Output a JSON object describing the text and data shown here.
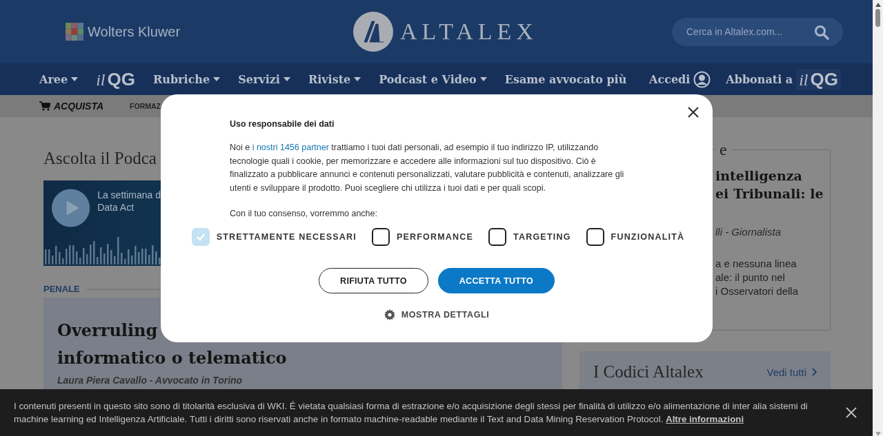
{
  "header": {
    "brand": "Wolters Kluwer",
    "logo": "ALTALEX",
    "search": {
      "placeholder": "Cerca in Altalex.com..."
    }
  },
  "nav": {
    "items": [
      {
        "label": "Aree",
        "kind": "menu",
        "dropdown": true
      },
      {
        "prefix": "il",
        "label": "QG",
        "kind": "logo",
        "dropdown": false
      },
      {
        "label": "Rubriche",
        "kind": "menu",
        "dropdown": true
      },
      {
        "label": "Servizi",
        "kind": "menu",
        "dropdown": true
      },
      {
        "label": "Riviste",
        "kind": "menu",
        "dropdown": true
      },
      {
        "label": "Podcast e Video",
        "kind": "menu",
        "dropdown": true
      },
      {
        "label": "Esame avvocato più",
        "kind": "menu",
        "dropdown": false
      }
    ],
    "login": "Accedi",
    "subscribe": "Abbonati a",
    "subscribe_logo": {
      "prefix": "il",
      "label": "QG"
    }
  },
  "subnav": {
    "items": [
      "ACQUISTA",
      "FORMAZ"
    ]
  },
  "podcast": {
    "heading": "Ascolta il Podca",
    "title_lines": [
      "La settimana d",
      "Data Act"
    ]
  },
  "article": {
    "category": "PENALE",
    "title_lines": [
      "Overruling",
      "informatico o telematico"
    ],
    "author": "Laura Piera Cavallo - Avvocato in Torino"
  },
  "side_box": {
    "legend": "e",
    "title_lines": [
      "intelligenza",
      "ei Tribunali: le"
    ],
    "author": "lli - Giornalista",
    "text_lines": [
      "a e nessuna linea",
      "ale: il punto nel",
      "i Osservatori della"
    ]
  },
  "codes": {
    "title": "I Codici Altalex",
    "link": "Vedi tutti"
  },
  "consent": {
    "title": "Uso responsabile dei dati",
    "intro_before": "Noi e ",
    "partners_link": "i nostri 1456 partner",
    "intro_after": " trattiamo i tuoi dati personali, ad esempio il tuo indirizzo IP, utilizzando tecnologie quali i cookie, per memorizzare e accedere alle informazioni sul tuo dispositivo. Ciò è finalizzato a pubblicare annunci e contenuti personalizzati, valutare pubblicità e contenuti, analizzare gli utenti e sviluppare il prodotto. Puoi scegliere chi utilizza i tuoi dati e per quali scopi.",
    "consent_line": "Con il tuo consenso, vorremmo anche:",
    "categories": [
      {
        "label": "STRETTAMENTE NECESSARI",
        "checked": true,
        "disabled": true
      },
      {
        "label": "PERFORMANCE",
        "checked": false,
        "disabled": false
      },
      {
        "label": "TARGETING",
        "checked": false,
        "disabled": false
      },
      {
        "label": "FUNZIONALITÀ",
        "checked": false,
        "disabled": false
      }
    ],
    "buttons": [
      {
        "label": "RIFIUTA TUTTO",
        "kind": "outline"
      },
      {
        "label": "ACCETTA TUTTO",
        "kind": "primary"
      }
    ],
    "details": "MOSTRA DETTAGLI"
  },
  "notice": {
    "text": "I contenuti presenti in questo sito sono di titolarità esclusiva di WKI. É vietata qualsiasi forma di estrazione e/o acquisizione degli stessi per finalità di utilizzo e/o alimentazione di inter alia sistemi di machine learning ed Intelligenza Artificiale. Tutti i diritti sono riservati anche in formato machine-readable mediante il Text and Data Mining Reservation Protocol. ",
    "link": "Altre informazioni"
  }
}
